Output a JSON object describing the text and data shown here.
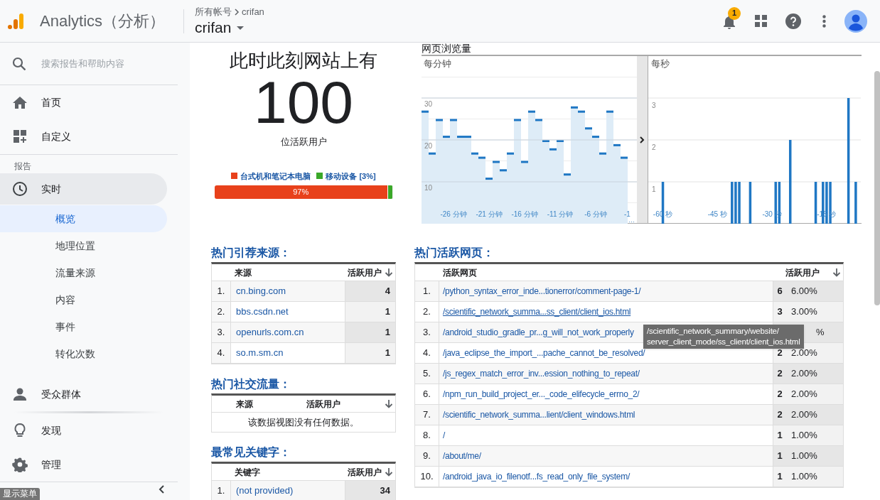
{
  "header": {
    "product": "Analytics（分析）",
    "breadcrumb": [
      "所有帐号",
      "crifan"
    ],
    "property": "crifan",
    "notification_count": "1"
  },
  "sidebar": {
    "search_placeholder": "搜索报告和帮助内容",
    "top_items": [
      {
        "label": "首页",
        "selected": false
      },
      {
        "label": "自定义",
        "selected": false
      }
    ],
    "section_label": "报告",
    "report_items": [
      {
        "label": "实时",
        "selected": true,
        "expanded": true,
        "children": [
          {
            "label": "概览",
            "selected": true
          },
          {
            "label": "地理位置",
            "selected": false
          },
          {
            "label": "流量来源",
            "selected": false
          },
          {
            "label": "内容",
            "selected": false
          },
          {
            "label": "事件",
            "selected": false
          },
          {
            "label": "转化次数",
            "selected": false
          }
        ]
      },
      {
        "label": "受众群体",
        "selected": false
      },
      {
        "label": "发现",
        "selected": false
      },
      {
        "label": "管理",
        "selected": false
      }
    ],
    "collapse_tooltip": "显示菜单"
  },
  "realtime": {
    "heading": "此时此刻网站上有",
    "count": "100",
    "count_label": "位活跃用户",
    "bar_reading": "97%",
    "devices": [
      {
        "label": "台式机和笔记本电脑",
        "color": "#e8411b",
        "level": 0.97
      },
      {
        "label": "移动设备 [3%]",
        "color": "#3aa829",
        "level": 0.03
      }
    ]
  },
  "pageviews": {
    "title": "网页浏览量",
    "per_minute": {
      "label": "每分钟",
      "overflow_label": "…",
      "chart_data": {
        "type": "bar",
        "grid": true,
        "x": [
          -30,
          -29,
          -28,
          -27,
          -26,
          -25,
          -24,
          -23,
          -22,
          -21,
          -20,
          -19,
          -18,
          -17,
          -16,
          -15,
          -14,
          -13,
          -12,
          -11,
          -10,
          -9,
          -8,
          -7,
          -6,
          -5,
          -4,
          -3,
          -2
        ],
        "series": [
          {
            "color": "#deecf7",
            "values": [
              27,
              17,
              25,
              21,
              25,
              21,
              21,
              17,
              16,
              11,
              15,
              13,
              17,
              25,
              15,
              27,
              25,
              20,
              18,
              20,
              12,
              28,
              27,
              23,
              21,
              17,
              27,
              19,
              16
            ]
          }
        ],
        "xlim": [
          -30.5,
          -0.2
        ],
        "ylim": [
          0,
          40
        ],
        "yticks": [
          10,
          20,
          30
        ],
        "xticks": [
          {
            "value": -26,
            "label": "-26 分钟"
          },
          {
            "value": -21,
            "label": "-21 分钟"
          },
          {
            "value": -16,
            "label": "-16 分钟"
          },
          {
            "value": -11,
            "label": "-11 分钟"
          },
          {
            "value": -6,
            "label": "-6 分钟"
          },
          {
            "value": -1,
            "label": "-1"
          }
        ]
      }
    },
    "per_second": {
      "label": "每秒",
      "chart_data": {
        "type": "bar",
        "grid": true,
        "x": [
          -60,
          -41,
          -40,
          -39,
          -36,
          -29,
          -28,
          -25,
          -18,
          -16,
          -15,
          -14,
          -9,
          -7
        ],
        "series": [
          {
            "color": "#1f77c4",
            "values": [
              1,
              1,
              1,
              1,
              1,
              1,
              1,
              2,
              1,
              1,
              1,
              1,
              3,
              1
            ]
          }
        ],
        "xlim": [
          -64,
          -5.6
        ],
        "ylim": [
          0,
          4
        ],
        "yticks": [
          1,
          2,
          3
        ],
        "xticks": [
          {
            "value": -60,
            "label": "-60 秒"
          },
          {
            "value": -45,
            "label": "-45 秒"
          },
          {
            "value": -30,
            "label": "-30 秒"
          },
          {
            "value": -15,
            "label": "-15 秒"
          }
        ]
      }
    }
  },
  "referrals": {
    "title": "热门引荐来源：",
    "columns": [
      "来源",
      "活跃用户"
    ],
    "rows": [
      {
        "rank": "1.",
        "source": "cn.bing.com",
        "users": "4"
      },
      {
        "rank": "2.",
        "source": "bbs.csdn.net",
        "users": "1"
      },
      {
        "rank": "3.",
        "source": "openurls.com.cn",
        "users": "1"
      },
      {
        "rank": "4.",
        "source": "so.m.sm.cn",
        "users": "1"
      }
    ]
  },
  "social": {
    "title": "热门社交流量：",
    "columns": [
      "来源",
      "活跃用户"
    ],
    "empty_message": "该数据视图没有任何数据。"
  },
  "keywords": {
    "title": "最常见关键字：",
    "columns": [
      "关键字",
      "活跃用户"
    ],
    "rows": [
      {
        "rank": "1.",
        "source": "(not provided)",
        "users": "34"
      }
    ]
  },
  "top_pages": {
    "title": "热门活跃网页：",
    "columns": [
      "活跃网页",
      "活跃用户"
    ],
    "rows": [
      {
        "rank": "1.",
        "page": "/python_syntax_error_inde...tionerror/comment-page-1/",
        "users": "6",
        "percent": "6.00%",
        "hovered": false
      },
      {
        "rank": "2.",
        "page": "/scientific_network_summa...ss_client/client_ios.html",
        "users": "3",
        "percent": "3.00%",
        "hovered": true
      },
      {
        "rank": "3.",
        "page": "/android_studio_gradle_pr...g_will_not_work_properly",
        "percent": "%",
        "hovered": false
      },
      {
        "rank": "4.",
        "page": "/java_eclipse_the_import_...pache_cannot_be_resolved/",
        "users": "2",
        "percent": "2.00%",
        "hovered": false
      },
      {
        "rank": "5.",
        "page": "/js_regex_match_error_inv...ession_nothing_to_repeat/",
        "users": "2",
        "percent": "2.00%",
        "hovered": false
      },
      {
        "rank": "6.",
        "page": "/npm_run_build_project_er..._code_elifecycle_errno_2/",
        "users": "2",
        "percent": "2.00%",
        "hovered": false
      },
      {
        "rank": "7.",
        "page": "/scientific_network_summa...lient/client_windows.html",
        "users": "2",
        "percent": "2.00%",
        "hovered": false
      },
      {
        "rank": "8.",
        "page": "/",
        "users": "1",
        "percent": "1.00%",
        "hovered": false
      },
      {
        "rank": "9.",
        "page": "/about/me/",
        "users": "1",
        "percent": "1.00%",
        "hovered": false
      },
      {
        "rank": "10.",
        "page": "/android_java_io_filenotf...fs_read_only_file_system/",
        "users": "1",
        "percent": "1.00%",
        "hovered": false
      }
    ]
  },
  "tooltip": {
    "lines": [
      "/scientific_network_summary/website/",
      "server_client_mode/ss_client/client_ios.html"
    ]
  }
}
